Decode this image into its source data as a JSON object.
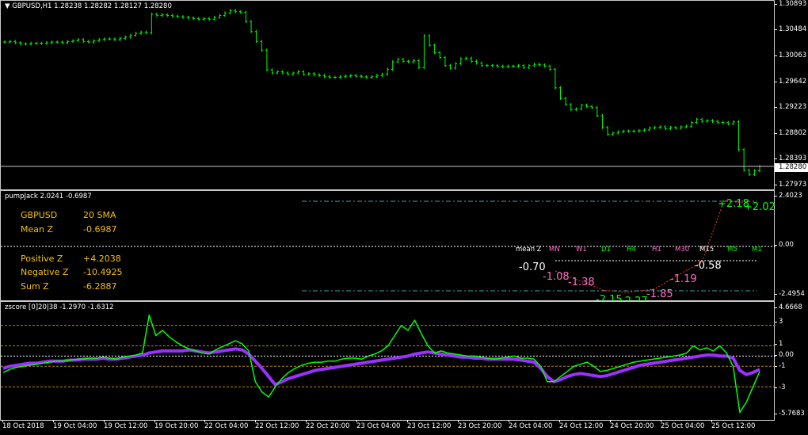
{
  "main": {
    "title": "GBPUSD,H1  1.28238 1.28282 1.28127 1.28280",
    "price_ticks": [
      "1.30893",
      "1.30484",
      "1.30063",
      "1.29642",
      "1.29223",
      "1.28802",
      "1.28393",
      "1.27973"
    ],
    "current_price": "1.28280",
    "colors": {
      "candle": "#00ff00",
      "background": "#000000",
      "grid_border": "#c8c8c8"
    },
    "candles": [
      1.3029,
      1.303,
      1.3028,
      1.3026,
      1.3026,
      1.3027,
      1.3027,
      1.3027,
      1.3028,
      1.3029,
      1.3029,
      1.3028,
      1.303,
      1.3031,
      1.3033,
      1.303,
      1.3029,
      1.3031,
      1.3033,
      1.3034,
      1.3034,
      1.3033,
      1.3035,
      1.3037,
      1.304,
      1.3043,
      1.3045,
      1.3044,
      1.3074,
      1.3072,
      1.3073,
      1.3072,
      1.3071,
      1.307,
      1.3069,
      1.3068,
      1.3067,
      1.3066,
      1.3067,
      1.3066,
      1.3069,
      1.3072,
      1.3076,
      1.308,
      1.3078,
      1.3077,
      1.3062,
      1.3046,
      1.303,
      1.3016,
      1.2984,
      1.2979,
      1.2981,
      1.2979,
      1.2977,
      1.2979,
      1.2981,
      1.2977,
      1.2978,
      1.2976,
      1.2975,
      1.2973,
      1.2972,
      1.2972,
      1.2973,
      1.2974,
      1.2975,
      1.2974,
      1.2973,
      1.2972,
      1.2973,
      1.2975,
      1.2977,
      1.2985,
      1.2997,
      1.3001,
      1.2998,
      1.2997,
      1.2999,
      1.2988,
      1.3039,
      1.3024,
      1.3012,
      1.3004,
      1.2991,
      1.2987,
      1.2994,
      1.3002,
      1.3003,
      1.2998,
      1.2995,
      1.2991,
      1.2991,
      1.2991,
      1.299,
      1.2989,
      1.299,
      1.299,
      1.2991,
      1.2988,
      1.2991,
      1.2993,
      1.2992,
      1.299,
      1.2985,
      1.2955,
      1.2938,
      1.2928,
      1.292,
      1.2921,
      1.2927,
      1.2925,
      1.2923,
      1.291,
      1.2891,
      1.288,
      1.2882,
      1.2884,
      1.2885,
      1.2885,
      1.2885,
      1.2886,
      1.2887,
      1.289,
      1.2891,
      1.2892,
      1.2889,
      1.2891,
      1.289,
      1.2892,
      1.2893,
      1.2899,
      1.2904,
      1.2901,
      1.2902,
      1.2901,
      1.2899,
      1.2899,
      1.2897,
      1.29,
      1.2855,
      1.2822,
      1.2815,
      1.2821,
      1.2828
    ]
  },
  "pump": {
    "title": "pumpJack 2.0241 -0.6987",
    "ticks": [
      "2.4023",
      "0.00",
      "-2.4954"
    ],
    "info": {
      "symbol": "GBPUSD",
      "sma": "20 SMA",
      "mean_label": "Mean Z",
      "mean_value": "-0.6987",
      "pos_label": "Positive Z",
      "pos_value": "+4.2038",
      "neg_label": "Negative Z",
      "neg_value": "-10.4925",
      "sum_label": "Sum Z",
      "sum_value": "-6.2887"
    },
    "tf_header": "mean Z",
    "timeframes": [
      "MN",
      "W1",
      "D1",
      "H4",
      "H1",
      "M30",
      "M15",
      "M5",
      "M1"
    ],
    "tf_colors": [
      "#ff6ec7",
      "#ff6ec7",
      "#00ff00",
      "#00ff00",
      "#ff6ec7",
      "#ff6ec7",
      "#ffffff",
      "#00ff00",
      "#00ff00"
    ],
    "z_labels": [
      "-0.70",
      "-1.08",
      "-1.38",
      "-2.15",
      "-2.27",
      "-1.85",
      "-1.19",
      "-0.58",
      "+2.18",
      "+2.02"
    ],
    "z_colors": [
      "#ffffff",
      "#ff6ec7",
      "#ff6ec7",
      "#00ff00",
      "#00ff00",
      "#ff6ec7",
      "#ff6ec7",
      "#ffffff",
      "#00ff00",
      "#00ff00"
    ]
  },
  "zscore": {
    "title": "zscore [0]20|38 -1.2970 -1.6312",
    "ticks": [
      "4.6668",
      "3",
      "1",
      "0.00",
      "-1",
      "-3",
      "-5.7683"
    ],
    "green": [
      -1.6,
      -1.3,
      -1.1,
      -1.0,
      -0.9,
      -0.8,
      -0.7,
      -0.6,
      -0.5,
      -0.5,
      -0.4,
      -0.3,
      -0.3,
      -0.2,
      -0.2,
      -0.1,
      -0.2,
      -0.3,
      -0.1,
      0.0,
      0.1,
      0.3,
      4.0,
      2.0,
      2.5,
      1.9,
      1.4,
      1.0,
      0.7,
      0.5,
      0.3,
      0.2,
      0.6,
      0.9,
      1.2,
      1.5,
      1.2,
      0.5,
      -2.5,
      -3.5,
      -4.0,
      -3.0,
      -2.2,
      -1.6,
      -1.2,
      -0.9,
      -0.7,
      -0.6,
      -0.6,
      -0.5,
      -0.5,
      -0.3,
      -0.2,
      -0.2,
      -0.3,
      0.0,
      0.2,
      0.5,
      1.0,
      2.0,
      3.0,
      2.5,
      3.5,
      2.2,
      1.0,
      0.3,
      0.5,
      0.3,
      0.2,
      0.1,
      0.0,
      0.0,
      -0.1,
      -0.2,
      -0.3,
      -0.2,
      -0.1,
      0.0,
      -0.2,
      -0.2,
      -0.3,
      -1.0,
      -2.5,
      -2.5,
      -2.0,
      -1.5,
      -1.0,
      -0.8,
      -0.6,
      -1.0,
      -1.5,
      -1.4,
      -1.2,
      -1.0,
      -0.8,
      -0.6,
      -0.5,
      -0.4,
      -0.3,
      -0.2,
      -0.1,
      0.0,
      0.1,
      0.3,
      1.0,
      0.6,
      0.8,
      0.5,
      1.0,
      0.3,
      -1.0,
      -5.5,
      -4.5,
      -3.0,
      -1.5
    ],
    "purple": [
      -1.2,
      -1.0,
      -0.9,
      -0.8,
      -0.7,
      -0.7,
      -0.6,
      -0.5,
      -0.5,
      -0.5,
      -0.4,
      -0.4,
      -0.3,
      -0.3,
      -0.3,
      -0.2,
      -0.3,
      -0.3,
      -0.2,
      -0.1,
      0.0,
      0.1,
      0.3,
      0.4,
      0.5,
      0.5,
      0.5,
      0.5,
      0.6,
      0.5,
      0.4,
      0.3,
      0.4,
      0.5,
      0.6,
      0.7,
      0.6,
      0.2,
      -0.5,
      -1.2,
      -2.0,
      -2.8,
      -2.5,
      -2.2,
      -2.0,
      -1.8,
      -1.6,
      -1.4,
      -1.3,
      -1.2,
      -1.1,
      -1.0,
      -0.9,
      -0.8,
      -0.7,
      -0.6,
      -0.5,
      -0.4,
      -0.3,
      -0.2,
      -0.1,
      0.0,
      0.2,
      0.3,
      0.4,
      0.3,
      0.2,
      0.1,
      0.0,
      -0.1,
      -0.1,
      -0.2,
      -0.2,
      -0.3,
      -0.3,
      -0.3,
      -0.3,
      -0.3,
      -0.4,
      -0.5,
      -0.6,
      -1.2,
      -2.0,
      -2.5,
      -2.3,
      -2.0,
      -1.8,
      -1.7,
      -1.8,
      -1.9,
      -2.0,
      -1.9,
      -1.7,
      -1.5,
      -1.3,
      -1.1,
      -0.9,
      -0.8,
      -0.7,
      -0.6,
      -0.5,
      -0.4,
      -0.3,
      -0.2,
      -0.1,
      0.0,
      0.1,
      0.1,
      0.0,
      0.0,
      -0.2,
      -1.4,
      -1.8,
      -1.6,
      -1.3
    ]
  },
  "xaxis": {
    "labels": [
      "18 Oct 2018",
      "19 Oct 04:00",
      "19 Oct 12:00",
      "19 Oct 20:00",
      "22 Oct 04:00",
      "22 Oct 12:00",
      "22 Oct 20:00",
      "23 Oct 04:00",
      "23 Oct 12:00",
      "23 Oct 20:00",
      "24 Oct 04:00",
      "24 Oct 12:00",
      "24 Oct 20:00",
      "25 Oct 04:00",
      "25 Oct 12:00"
    ]
  }
}
